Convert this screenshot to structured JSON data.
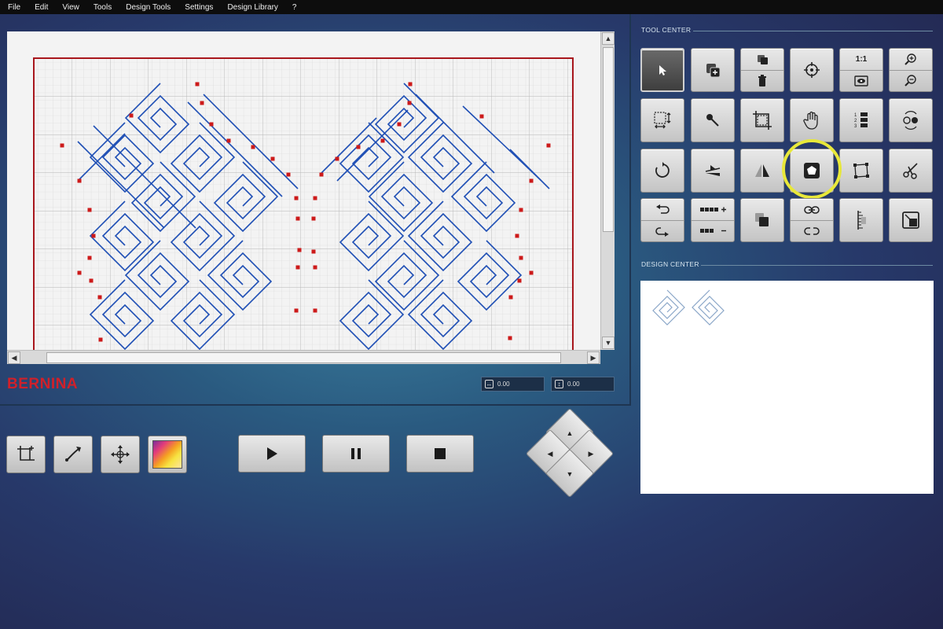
{
  "menu": [
    "File",
    "Edit",
    "View",
    "Tools",
    "Design Tools",
    "Settings",
    "Design Library",
    "?"
  ],
  "brand": {
    "logo": "BERNINA",
    "color": "#d0202a"
  },
  "coordinates": {
    "width_value": "0.00",
    "height_value": "0.00",
    "width_icon": "horizontal-resize-icon",
    "height_icon": "vertical-resize-icon"
  },
  "tool_center": {
    "title": "TOOL CENTER",
    "zoom_label": "1:1",
    "selected_tool": "select-icon",
    "highlighted_tool": "polygon-node-icon",
    "highlight_color": "#e8e83a"
  },
  "design_center": {
    "title": "DESIGN CENTER"
  },
  "canvas": {
    "grid_color": "#c8c8c8",
    "border_color": "#a8161c",
    "stitch_color": "#1f4fb5",
    "node_color": "#cc1a1a"
  },
  "bottom_toolbar": {
    "left_tools": [
      "crop-add-icon",
      "draw-line-icon",
      "move-arrows-icon",
      "color-swatch-icon"
    ],
    "playback": [
      "play-icon",
      "pause-icon",
      "stop-icon"
    ],
    "dpad": [
      "up-arrow-icon",
      "left-arrow-icon",
      "right-arrow-icon",
      "down-arrow-icon"
    ]
  }
}
